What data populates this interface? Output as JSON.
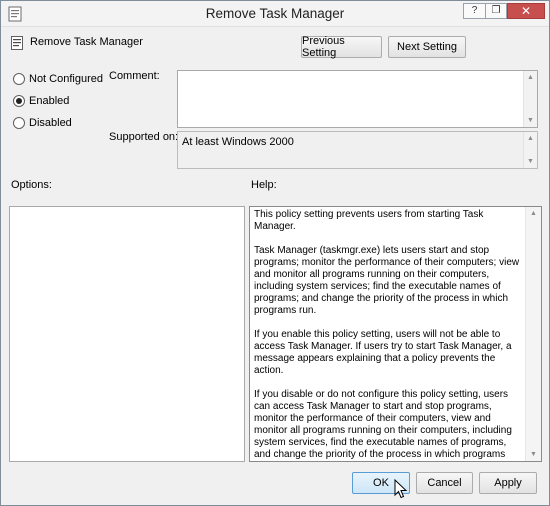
{
  "window": {
    "title": "Remove Task Manager",
    "controls": {
      "help": "?",
      "restore": "❐",
      "close": "✕"
    }
  },
  "header": {
    "policy_name": "Remove Task Manager",
    "previous_button": "Previous Setting",
    "next_button": "Next Setting"
  },
  "state": {
    "options": [
      {
        "label": "Not Configured",
        "selected": false
      },
      {
        "label": "Enabled",
        "selected": true
      },
      {
        "label": "Disabled",
        "selected": false
      }
    ]
  },
  "comment": {
    "label": "Comment:",
    "value": ""
  },
  "supported": {
    "label": "Supported on:",
    "value": "At least Windows 2000"
  },
  "options_panel": {
    "label": "Options:"
  },
  "help_panel": {
    "label": "Help:",
    "paragraphs": [
      "This policy setting prevents users from starting Task Manager.",
      "Task Manager (taskmgr.exe) lets users start and stop programs; monitor the performance of their computers; view and monitor all programs running on their computers, including system services; find the executable names of programs; and change the priority of the process in which programs run.",
      "If you enable this policy setting, users will not be able to access Task Manager. If users try to start Task Manager, a message appears explaining that a policy prevents the action.",
      "If you disable or do not configure this policy setting, users can access Task Manager to  start and stop programs, monitor the performance of their computers, view and monitor all programs running on their computers, including system services, find the executable names of programs, and change the priority of the process in which programs run."
    ]
  },
  "footer": {
    "ok": "OK",
    "cancel": "Cancel",
    "apply": "Apply"
  },
  "colors": {
    "close_button": "#c7504f",
    "ok_border": "#5a9cd6"
  },
  "icons": [
    "policy-icon",
    "title-icon",
    "mouse-cursor-icon"
  ]
}
